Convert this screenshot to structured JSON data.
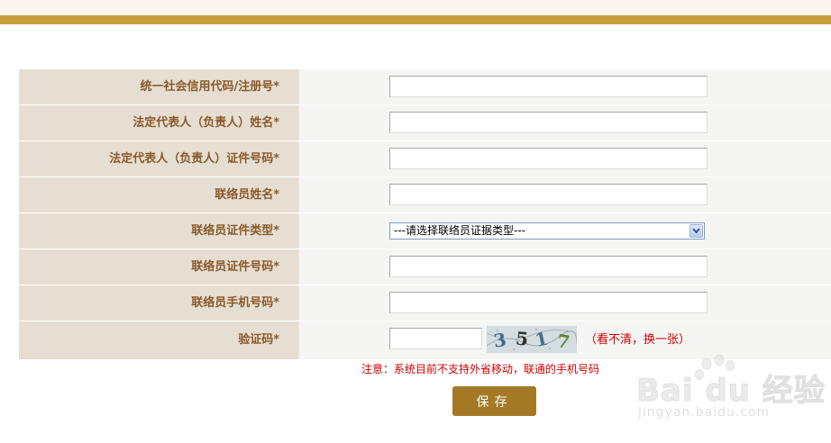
{
  "header": {
    "strip_color": "#faf6ee",
    "bar_color": "#c89d3a"
  },
  "form": {
    "fields": [
      {
        "label": "统一社会信用代码/注册号*",
        "value": "",
        "type": "text"
      },
      {
        "label": "法定代表人（负责人）姓名*",
        "value": "",
        "type": "text"
      },
      {
        "label": "法定代表人（负责人）证件号码*",
        "value": "",
        "type": "text"
      },
      {
        "label": "联络员姓名*",
        "value": "",
        "type": "text"
      },
      {
        "label": "联络员证件类型*",
        "value": "---请选择联络员证据类型---",
        "type": "select"
      },
      {
        "label": "联络员证件号码*",
        "value": "",
        "type": "text"
      },
      {
        "label": "联络员手机号码*",
        "value": "",
        "type": "text"
      }
    ],
    "captcha": {
      "label": "验证码*",
      "value": "",
      "image_text": "3517",
      "refresh_text": "（看不清，换一张）"
    },
    "notice": "注意：系统目前不支持外省移动，联通的手机号码",
    "save_label": "保存"
  },
  "watermark": {
    "brand": "Bai du 经验",
    "url": "jingyan.baidu.com"
  },
  "colors": {
    "label_bg": "#e6ded2",
    "label_text": "#8a5a2a",
    "input_bg": "#f5f5f3",
    "notice": "#cc0000",
    "button": "#a47a27"
  }
}
